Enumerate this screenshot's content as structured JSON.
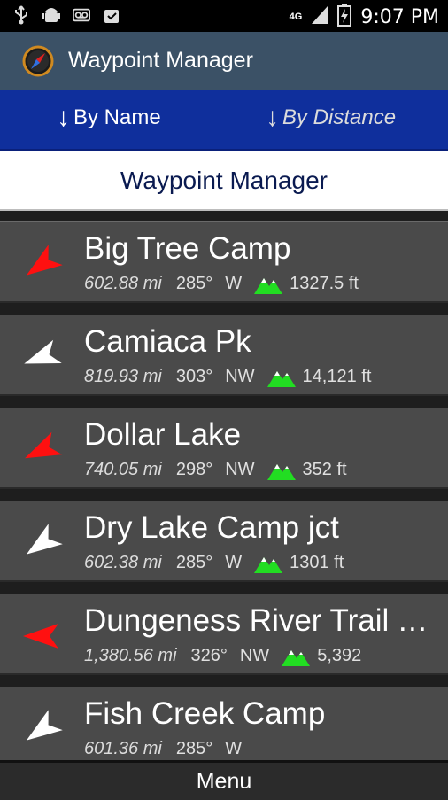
{
  "status_bar": {
    "network": "4G",
    "time": "9:07 PM",
    "icons": [
      "usb-icon",
      "android-debug-icon",
      "voicemail-icon",
      "clipboard-check-icon",
      "signal-icon",
      "battery-charging-icon"
    ]
  },
  "app": {
    "title": "Waypoint Manager",
    "icon": "compass-icon"
  },
  "sort": {
    "by_name_label": "By Name",
    "by_distance_label": "By Distance",
    "arrow": "↓"
  },
  "header": {
    "title": "Waypoint Manager"
  },
  "colors": {
    "title_bar": "#3b5166",
    "sort_bar": "#0f2f9c",
    "row_bg": "#4a4a4a",
    "arrow_red": "#ff1010",
    "arrow_white": "#ffffff",
    "mountain_green": "#22dd22"
  },
  "waypoints": [
    {
      "name": "Big Tree Camp",
      "distance": "602.88 mi",
      "bearing": "285°",
      "direction": "W",
      "elevation": "1327.5 ft",
      "arrow_color": "red",
      "arrow_rotation": 235
    },
    {
      "name": "Camiaca Pk",
      "distance": "819.93 mi",
      "bearing": "303°",
      "direction": "NW",
      "elevation": "14,121 ft",
      "arrow_color": "white",
      "arrow_rotation": 250
    },
    {
      "name": "Dollar Lake",
      "distance": "740.05 mi",
      "bearing": "298°",
      "direction": "NW",
      "elevation": "352 ft",
      "arrow_color": "red",
      "arrow_rotation": 245
    },
    {
      "name": "Dry Lake Camp jct",
      "distance": "602.38 mi",
      "bearing": "285°",
      "direction": "W",
      "elevation": "1301 ft",
      "arrow_color": "white",
      "arrow_rotation": 235
    },
    {
      "name": "Dungeness River Trail T…",
      "distance": "1,380.56 mi",
      "bearing": "326°",
      "direction": "NW",
      "elevation": "5,392",
      "arrow_color": "red",
      "arrow_rotation": 270
    },
    {
      "name": "Fish Creek Camp",
      "distance": "601.36 mi",
      "bearing": "285°",
      "direction": "W",
      "elevation": "",
      "arrow_color": "white",
      "arrow_rotation": 235
    }
  ],
  "menu": {
    "label": "Menu"
  }
}
